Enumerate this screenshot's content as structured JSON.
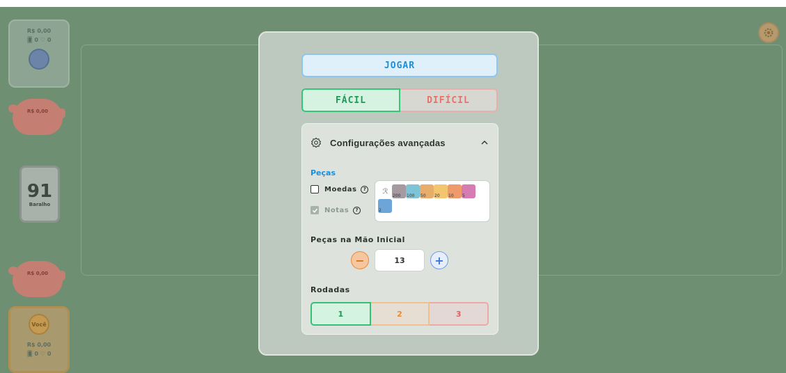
{
  "background": {
    "table_color": "#6e8f72"
  },
  "left_panel": {
    "top_player": {
      "money": "R$ 0,00",
      "stats": "🂠 0  ♡ 0"
    },
    "piggy_1": {
      "text": "R$ 0,00"
    },
    "deck": {
      "count": "91",
      "label": "Baralho"
    },
    "piggy_2": {
      "text": "R$ 0,00"
    },
    "you_player": {
      "avatar_label": "Você",
      "money": "R$ 0,00",
      "stats": "🂠 0  ♡ 0"
    }
  },
  "modal": {
    "play_label": "JOGAR",
    "difficulty": {
      "easy_label": "FÁCIL",
      "hard_label": "DIFÍCIL",
      "selected": "FÁCIL"
    },
    "advanced": {
      "title": "Configurações avançadas",
      "icons": {
        "settings": "gear-icon",
        "collapse": "chevron-up-icon"
      },
      "pieces_label": "Peças",
      "coins_label": "Moedas",
      "coins_checked": false,
      "notes_label": "Notas",
      "notes_checked": true,
      "bills": [
        {
          "label": "",
          "color": "none"
        },
        {
          "label": "200",
          "color": "#a49aa0"
        },
        {
          "label": "100",
          "color": "#7fc4d6"
        },
        {
          "label": "50",
          "color": "#e8ad6b"
        },
        {
          "label": "20",
          "color": "#f2c56e"
        },
        {
          "label": "10",
          "color": "#ee9a6a"
        },
        {
          "label": "5",
          "color": "#d77bb3"
        },
        {
          "label": "2",
          "color": "#6ea5d9"
        }
      ],
      "hand_label": "Peças na Mão Inicial",
      "hand_value": "13",
      "rounds_label": "Rodadas",
      "rounds": [
        "1",
        "2",
        "3"
      ],
      "rounds_selected": "1"
    }
  },
  "colors": {
    "accent_blue": "#1d8fd8",
    "easy_green": "#1c9a57",
    "hard_red": "#e8726a",
    "orange": "#ea8a32"
  }
}
